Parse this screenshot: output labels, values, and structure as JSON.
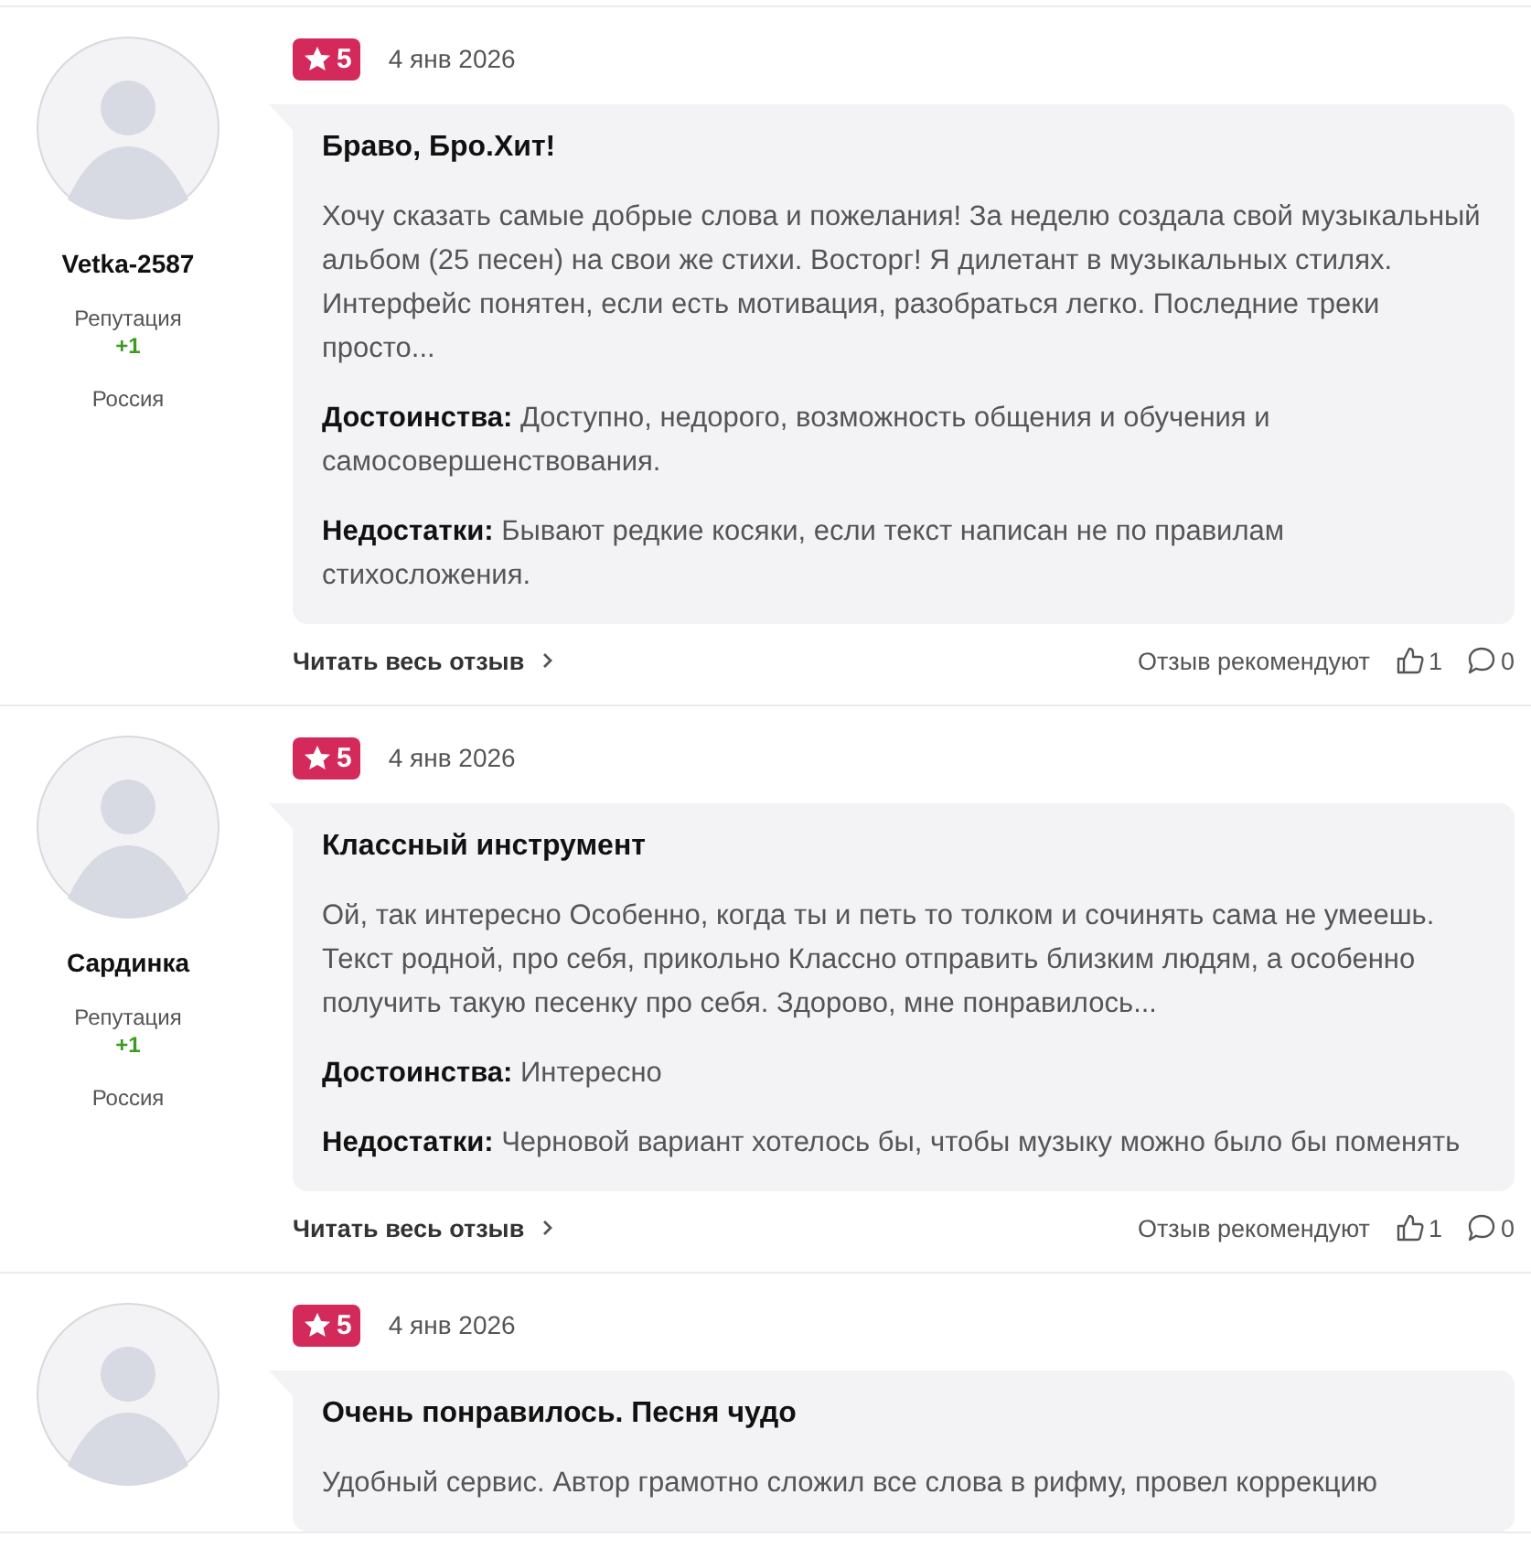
{
  "reviews": [
    {
      "author": "Vetka-2587",
      "reputation_label": "Репутация",
      "reputation": "+1",
      "country": "Россия",
      "rating": "5",
      "date": "4 янв 2026",
      "title": "Браво, Бро.Хит!",
      "body": "Хочу сказать самые добрые слова и пожелания! За неделю создала свой музыкальный альбом (25 песен) на свои же стихи. Восторг! Я дилетант в музыкальных стилях. Интерфейс понятен, если есть мотивация, разобраться легко. Последние треки просто...",
      "pros": "**Достоинства:** Доступно, недорого, возможность общения и обучения и самосовершенствования.",
      "cons": "**Недостатки:** Бывают редкие косяки, если текст написан не по правилам стихосложения.",
      "read_more": "Читать весь отзыв",
      "recommend_label": "Отзыв рекомендуют",
      "likes": "1",
      "comments": "0"
    },
    {
      "author": "Сардинка",
      "reputation_label": "Репутация",
      "reputation": "+1",
      "country": "Россия",
      "rating": "5",
      "date": "4 янв 2026",
      "title": "Классный инструмент",
      "body": "Ой, так интересно Особенно, когда ты и петь то толком и сочинять сама не умеешь. Текст родной, про себя, прикольно Классно отправить близким людям, а особенно получить такую песенку про себя. Здорово, мне понравилось...",
      "pros": "**Достоинства:** Интересно",
      "cons": "**Недостатки:** Черновой вариант хотелось бы, чтобы музыку можно было бы поменять",
      "read_more": "Читать весь отзыв",
      "recommend_label": "Отзыв рекомендуют",
      "likes": "1",
      "comments": "0"
    },
    {
      "rating": "5",
      "date": "4 янв 2026",
      "title": "Очень понравилось. Песня чудо",
      "body": "Удобный сервис. Автор грамотно сложил все слова в рифму, провел коррекцию"
    }
  ]
}
